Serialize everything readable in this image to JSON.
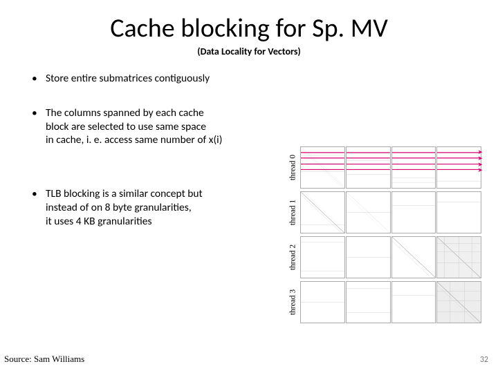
{
  "title": "Cache blocking for Sp. MV",
  "subtitle": "(Data Locality for Vectors)",
  "bullets": [
    {
      "lines": [
        "Store entire submatrices contiguously"
      ]
    },
    {
      "lines": [
        "The columns spanned by each cache",
        "block are selected to use same space",
        "in cache, i. e. access same number of x(i)"
      ]
    },
    {
      "lines": [
        "TLB blocking is a similar concept but",
        "instead of on 8 byte granularities,",
        "it uses 4 KB granularities"
      ]
    }
  ],
  "threads": [
    {
      "label": "thread 0"
    },
    {
      "label": "thread 1"
    },
    {
      "label": "thread 2"
    },
    {
      "label": "thread 3"
    }
  ],
  "source": "Source: Sam Williams",
  "page_number": "32"
}
